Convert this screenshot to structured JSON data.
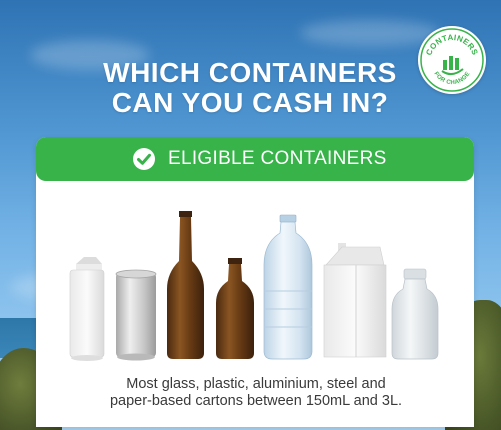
{
  "headline": {
    "line1": "WHICH CONTAINERS",
    "line2": "CAN YOU CASH IN?"
  },
  "logo": {
    "text_top": "CONTAINERS",
    "text_bottom": "FOR CHANGE",
    "icon": "bar-chart-leaf-logo"
  },
  "banner": {
    "icon": "check-circle-icon",
    "label": "ELIGIBLE CONTAINERS"
  },
  "containers": [
    {
      "name": "small-carton",
      "icon": "carton-icon"
    },
    {
      "name": "aluminium-can",
      "icon": "can-icon"
    },
    {
      "name": "tall-brown-glass-bottle",
      "icon": "glass-bottle-icon"
    },
    {
      "name": "short-brown-glass-bottle",
      "icon": "glass-bottle-icon"
    },
    {
      "name": "plastic-water-bottle",
      "icon": "plastic-bottle-icon"
    },
    {
      "name": "gable-top-carton",
      "icon": "carton-icon"
    },
    {
      "name": "small-glass-jar-bottle",
      "icon": "glass-bottle-icon"
    }
  ],
  "caption": {
    "line1": "Most glass, plastic, aluminium, steel and",
    "line2": "paper-based cartons between 150mL and 3L."
  },
  "colors": {
    "brand_green": "#37b34a",
    "sky_blue": "#4d94d0",
    "text_dark": "#3a3a3a",
    "white": "#ffffff"
  }
}
